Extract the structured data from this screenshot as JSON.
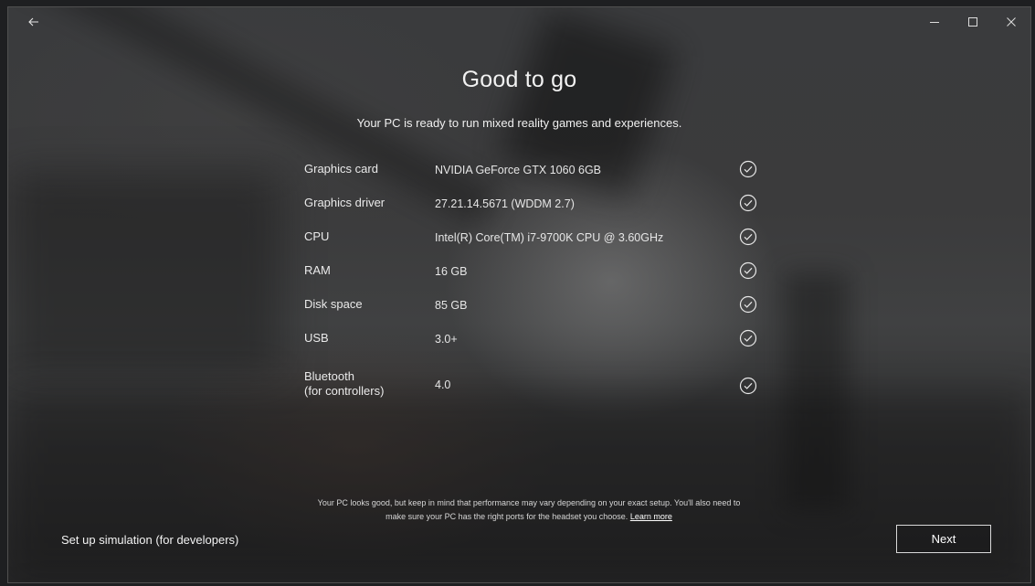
{
  "window": {
    "back_icon": "arrow-left-icon",
    "controls": [
      "minimize-icon",
      "maximize-icon",
      "close-icon"
    ]
  },
  "main": {
    "title": "Good to go",
    "subtitle": "Your PC is ready to run mixed reality games and experiences.",
    "specs": [
      {
        "label": "Graphics card",
        "value": "NVIDIA GeForce GTX 1060 6GB",
        "status": "check-circle-icon"
      },
      {
        "label": "Graphics driver",
        "value": "27.21.14.5671 (WDDM 2.7)",
        "status": "check-circle-icon"
      },
      {
        "label": "CPU",
        "value": "Intel(R) Core(TM) i7-9700K CPU @ 3.60GHz",
        "status": "check-circle-icon"
      },
      {
        "label": "RAM",
        "value": "16 GB",
        "status": "check-circle-icon"
      },
      {
        "label": "Disk space",
        "value": "85 GB",
        "status": "check-circle-icon"
      },
      {
        "label": "USB",
        "value": "3.0+",
        "status": "check-circle-icon"
      },
      {
        "label": "Bluetooth\n(for controllers)",
        "value": "4.0",
        "status": "check-circle-icon"
      }
    ],
    "footnote": "Your PC looks good, but keep in mind that performance may vary depending on your exact setup. You'll also need to make sure your PC has the right ports for the headset you choose.",
    "learn_more": "Learn more"
  },
  "footer": {
    "simulation_link": "Set up simulation (for developers)",
    "next_label": "Next"
  }
}
